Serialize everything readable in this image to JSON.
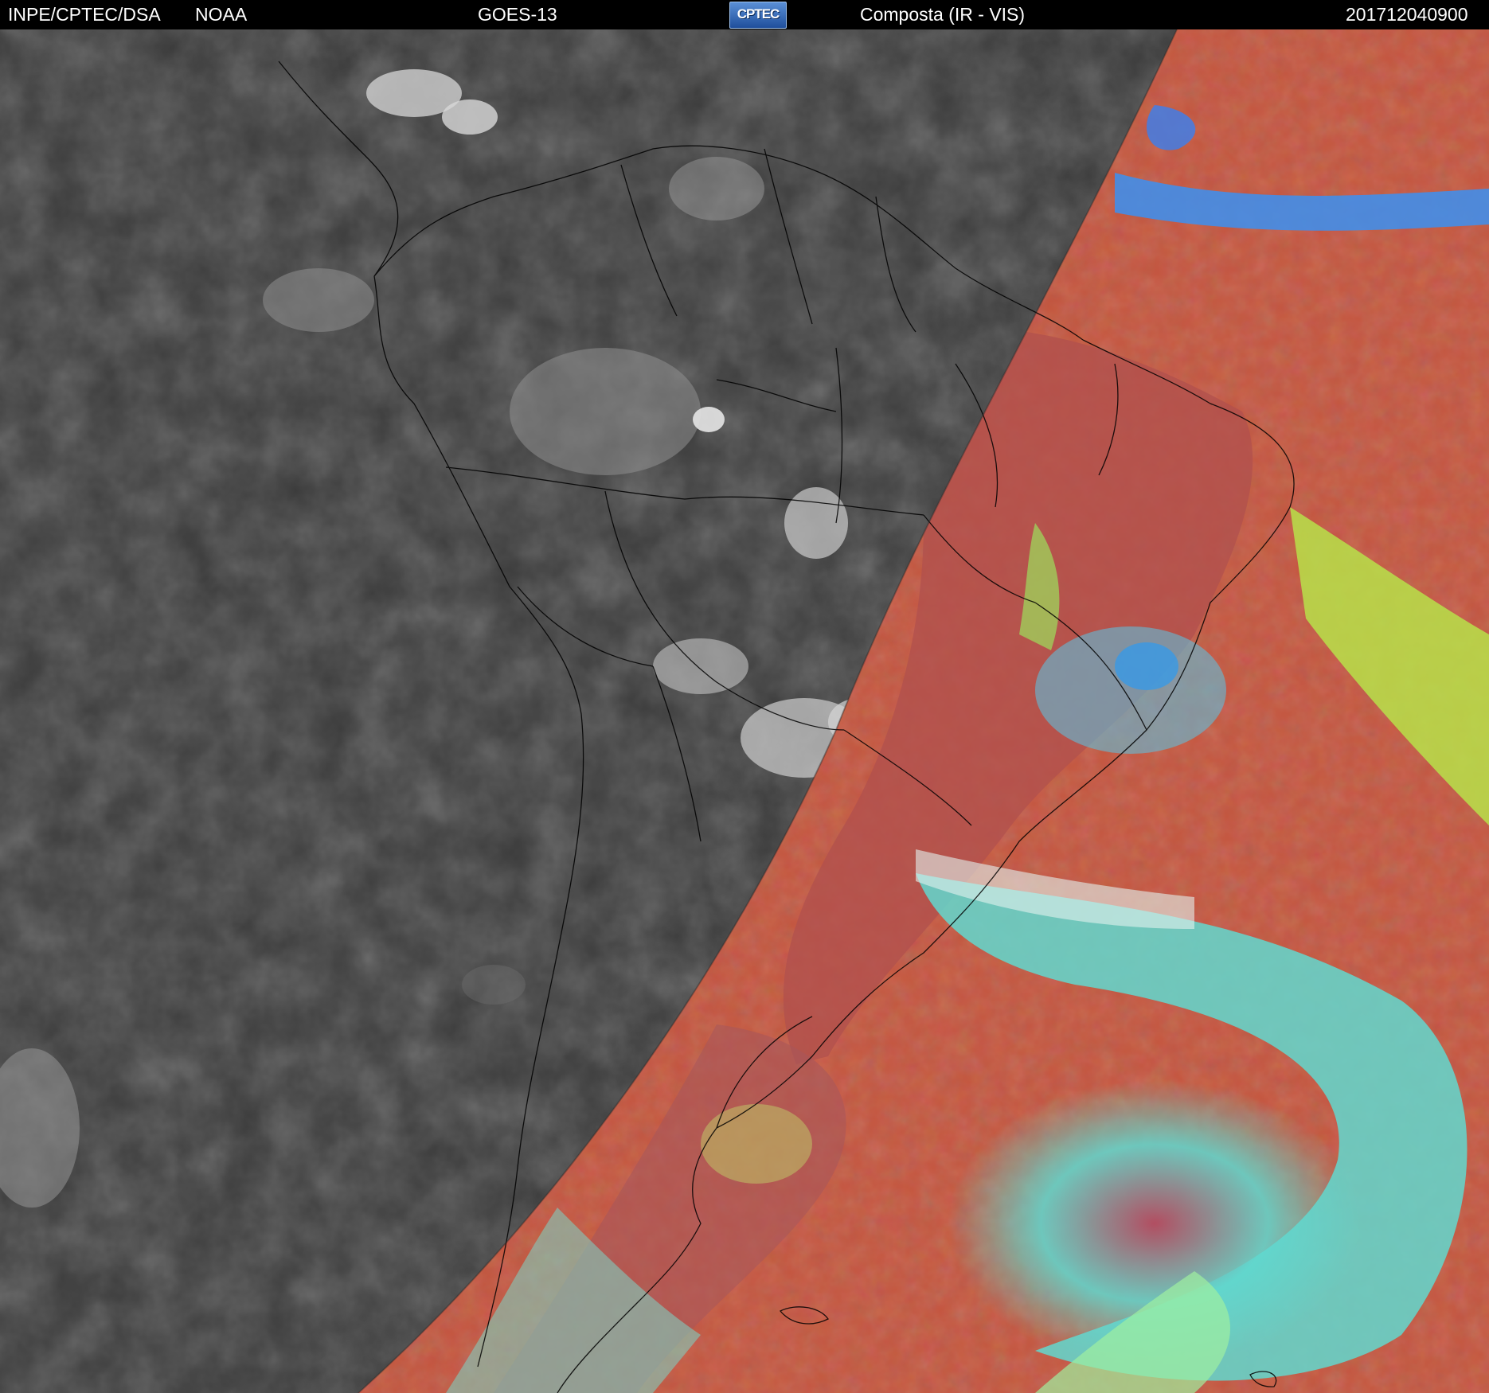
{
  "header": {
    "org": "INPE/CPTEC/DSA",
    "agency": "NOAA",
    "satellite": "GOES-13",
    "logo_text": "CPTEC",
    "product": "Composta (IR - VIS)",
    "timestamp": "201712040900"
  },
  "colors": {
    "header_bg": "#000000",
    "header_text": "#ffffff",
    "night_side": "#3b3b3b",
    "day_land_red": "#b5524a",
    "day_cloud_cyan": "#6fe0d8",
    "day_cloud_green": "#b4ea4c",
    "day_cloud_blue": "#3a8ff2",
    "coastline": "#000000"
  },
  "map": {
    "left_side": "infrared (night, grayscale)",
    "right_side": "visible composite (day, false color)",
    "overlays": [
      "coastlines",
      "country-borders",
      "state-borders"
    ]
  }
}
